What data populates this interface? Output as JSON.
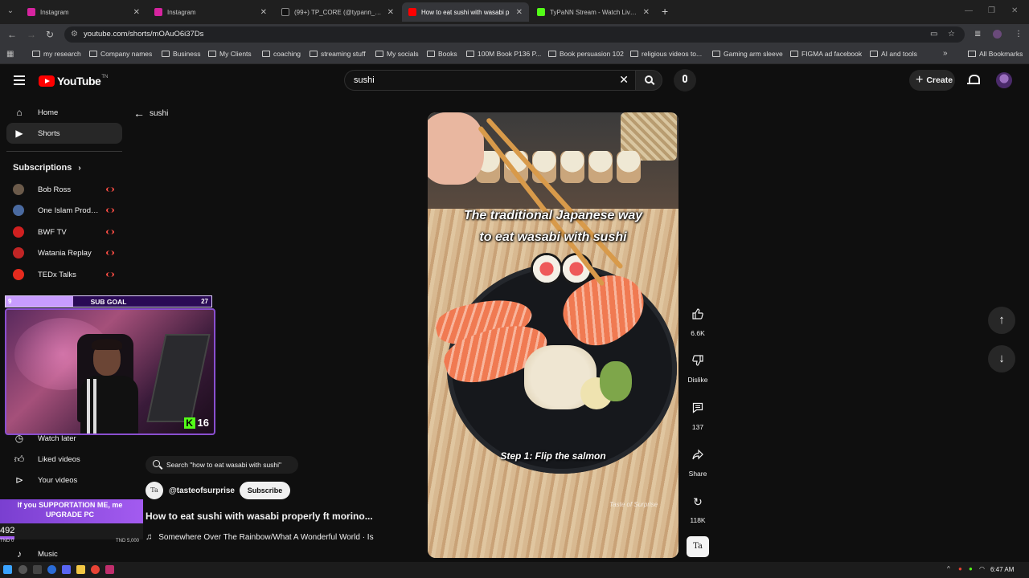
{
  "browser": {
    "tabs": [
      {
        "title": "Instagram",
        "favicon_color": "#d6249f",
        "active": false
      },
      {
        "title": "Instagram",
        "favicon_color": "#d6249f",
        "active": false
      },
      {
        "title": "(99+) TP_CORE (@typann_core)",
        "favicon_color": "#111111",
        "active": false
      },
      {
        "title": "How to eat sushi with wasabi p",
        "favicon_color": "#ff0000",
        "active": true
      },
      {
        "title": "TyPaNN Stream - Watch Live o",
        "favicon_color": "#53fc18",
        "active": false
      }
    ],
    "url": "youtube.com/shorts/mOAuO6i37Ds",
    "bookmarks": [
      "my research",
      "Company names",
      "Business",
      "My Clients",
      "coaching",
      "streaming stuff",
      "My socials",
      "Books",
      "100M Book P136 P...",
      "Book persuasion 102",
      "religious videos to...",
      "Gaming arm sleeve",
      "FIGMA ad facebook",
      "AI and tools"
    ],
    "all_bookmarks_label": "All Bookmarks"
  },
  "youtube": {
    "logo_text": "YouTube",
    "logo_tm": "TN",
    "search_query": "sushi",
    "create_label": "Create",
    "sidebar": {
      "home": "Home",
      "shorts": "Shorts",
      "subscriptions_heading": "Subscriptions",
      "subscriptions": [
        {
          "name": "Bob Ross",
          "color": "#6b5a4a"
        },
        {
          "name": "One Islam Produ...",
          "color": "#4a6aa0"
        },
        {
          "name": "BWF TV",
          "color": "#d02020"
        },
        {
          "name": "Watania Replay",
          "color": "#c02525"
        },
        {
          "name": "TEDx Talks",
          "color": "#e62b1e"
        }
      ],
      "watch_later": "Watch later",
      "liked_videos": "Liked videos",
      "your_videos": "Your videos",
      "music": "Music"
    },
    "back_query": "sushi",
    "short": {
      "caption_line1": "The traditional Japanese way",
      "caption_line2": "to eat wasabi with sushi",
      "step_caption": "Step 1: Flip the salmon",
      "watermark": "Taste of Surprise",
      "suggest_search": "Search \"how to eat wasabi with sushi\"",
      "channel_handle": "@tasteofsurprise",
      "channel_initials": "Ta",
      "subscribe_label": "Subscribe",
      "title": "How to eat sushi with wasabi properly ft morino...",
      "music": "Somewhere Over The Rainbow/What A Wonderful World · Is"
    },
    "actions": {
      "likes": "6.6K",
      "dislike": "Dislike",
      "comments": "137",
      "share": "Share",
      "remix": "118K"
    }
  },
  "overlay": {
    "sub_goal_label": "SUB GOAL",
    "sub_goal_current": "9",
    "sub_goal_target": "27",
    "sub_goal_progress": 0.33,
    "kick_count": "16",
    "support_text": "If you SUPPORTATION ME, me UPGRADE PC",
    "support_current": "492",
    "support_min": "TND 0",
    "support_max": "TND 5,000",
    "support_progress": 0.1
  },
  "taskbar": {
    "time": "6:47 AM"
  }
}
